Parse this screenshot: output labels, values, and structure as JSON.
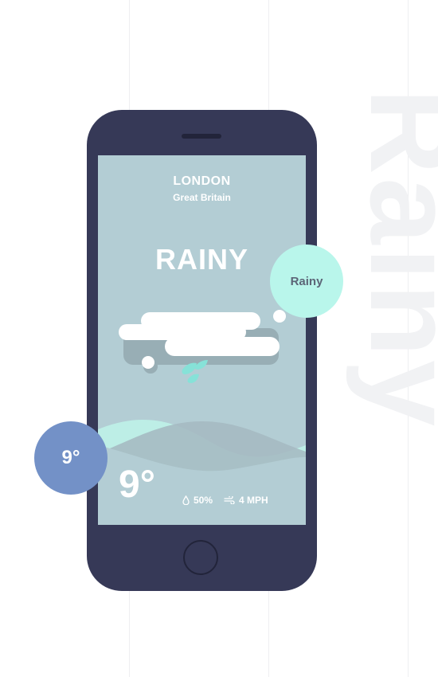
{
  "background_word": "Rainy",
  "weather": {
    "city": "LONDON",
    "country": "Great Britain",
    "condition": "RAINY",
    "temperature": "9°",
    "humidity": "50%",
    "wind": "4 MPH"
  },
  "badges": {
    "condition_label": "Rainy",
    "temperature_label": "9°"
  },
  "icons": {
    "humidity": "droplet-icon",
    "wind": "wind-icon",
    "weather": "cloud-rain-icon"
  },
  "colors": {
    "phone_body": "#363957",
    "screen_bg": "#b3cdd4",
    "accent_mint": "#b9f6eb",
    "accent_blue": "#7391c7",
    "text_white": "#ffffff"
  }
}
